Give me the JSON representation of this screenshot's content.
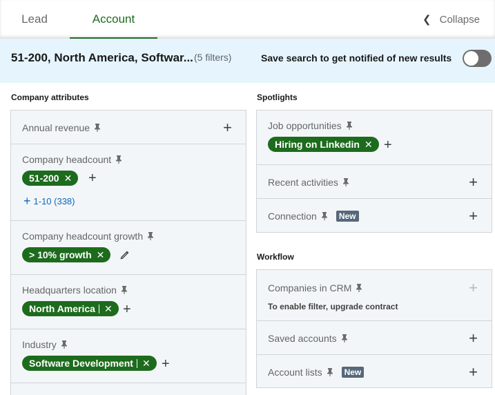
{
  "tabs": {
    "lead": "Lead",
    "account": "Account",
    "collapse": "Collapse"
  },
  "summary": {
    "title": "51-200, North America, Softwar...",
    "count": "(5 filters)",
    "save_label": "Save search to get notified of new results",
    "toggle_on": false
  },
  "sections": {
    "company_attributes": "Company attributes",
    "spotlights": "Spotlights",
    "workflow": "Workflow"
  },
  "company": {
    "annual_revenue": "Annual revenue",
    "headcount": "Company headcount",
    "headcount_pill": "51-200",
    "headcount_suggestion": "1-10 (338)",
    "headcount_growth": "Company headcount growth",
    "growth_pill": "> 10% growth",
    "hq_location": "Headquarters location",
    "hq_pill": "North America",
    "industry": "Industry",
    "industry_pill": "Software Development"
  },
  "spotlights": {
    "job_opportunities": "Job opportunities",
    "job_pill": "Hiring on Linkedin",
    "recent_activities": "Recent activities",
    "connection": "Connection",
    "connection_badge": "New"
  },
  "workflow": {
    "companies_in_crm": "Companies in CRM",
    "crm_note": "To enable filter, upgrade contract",
    "saved_accounts": "Saved accounts",
    "account_lists": "Account lists",
    "account_lists_badge": "New"
  },
  "colors": {
    "accent_green": "#1d6b1d",
    "link_blue": "#0a66c2",
    "summary_bg": "#e6f4fd",
    "card_bg": "#f3f6f8"
  }
}
